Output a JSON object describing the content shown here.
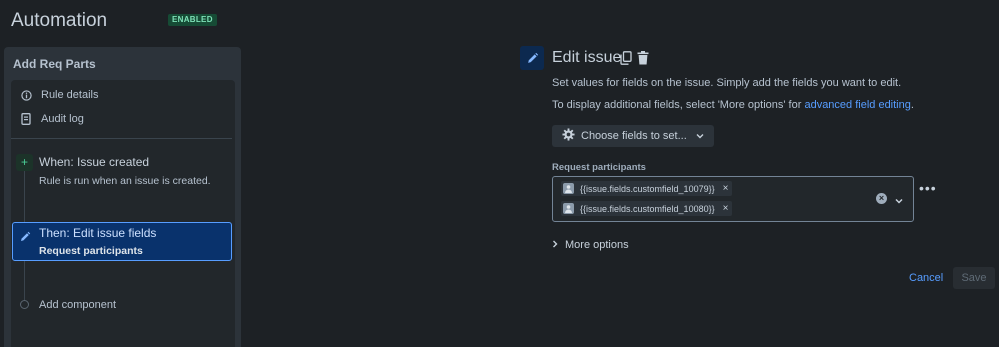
{
  "header": {
    "title": "Automation",
    "status_badge": "ENABLED"
  },
  "rule": {
    "name": "Add Req Parts",
    "nav": [
      {
        "label": "Rule details",
        "icon": "info-icon"
      },
      {
        "label": "Audit log",
        "icon": "document-icon"
      }
    ],
    "trigger": {
      "title": "When: Issue created",
      "description": "Rule is run when an issue is created."
    },
    "action": {
      "title": "Then: Edit issue fields",
      "subtitle": "Request participants"
    },
    "add_component": "Add component"
  },
  "editor": {
    "title": "Edit issue",
    "description_1": "Set values for fields on the issue. Simply add the fields you want to edit.",
    "description_2_prefix": "To display additional fields, select 'More options' for ",
    "description_2_link": "advanced field editing",
    "description_2_suffix": ".",
    "choose_fields_label": "Choose fields to set...",
    "field_label": "Request participants",
    "chips": [
      "{{issue.fields.customfield_10079}}",
      "{{issue.fields.customfield_10080}}"
    ],
    "more_options_label": "More options",
    "cancel_label": "Cancel",
    "save_label": "Save"
  },
  "colors": {
    "background": "#1d2125",
    "accent": "#579dff",
    "enabled_badge": "#164b35",
    "selected_card": "#09326c"
  }
}
